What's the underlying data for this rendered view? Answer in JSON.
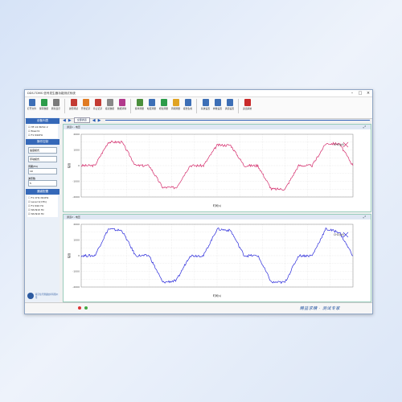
{
  "window": {
    "title": "DDS-TDMS 信号发生器功能测试系统"
  },
  "toolbar": [
    {
      "label": "打开文件",
      "color": "#3d6fb6"
    },
    {
      "label": "保存数据",
      "color": "#2c9c4a"
    },
    {
      "label": "刷新显示",
      "color": "#7a7a7a"
    },
    {
      "label": "波形测试",
      "color": "#c33b34"
    },
    {
      "label": "开始记录",
      "color": "#e07b22"
    },
    {
      "label": "停止记录",
      "color": "#c33b34"
    },
    {
      "label": "报表数据",
      "color": "#888888"
    },
    {
      "label": "数据清除",
      "color": "#b23a8c"
    },
    {
      "label": "频率测量",
      "color": "#4a8f3c"
    },
    {
      "label": "幅度测量",
      "color": "#3d6fb6"
    },
    {
      "label": "相位测量",
      "color": "#2c9c4a"
    },
    {
      "label": "周期测量",
      "color": "#e0a322"
    },
    {
      "label": "报告生成",
      "color": "#3d6fb6"
    },
    {
      "label": "系统设置",
      "color": "#3d6fb6"
    },
    {
      "label": "参数设置",
      "color": "#3d6fb6"
    },
    {
      "label": "通道设置",
      "color": "#3d6fb6"
    },
    {
      "label": "退出系统",
      "color": "#c92a2a"
    }
  ],
  "sidebar": {
    "device_header": "设备列表",
    "device_items": [
      "☑ HF-CX BVSC 2",
      "  ☑ Board1",
      "  ☑ F1 N10Hz"
    ],
    "ops_header": "操作控制",
    "controls": [
      {
        "label": "",
        "value": "速度模式"
      },
      {
        "label": "",
        "value": "手动模式"
      },
      {
        "label": "周期(Hz)",
        "value": "10"
      },
      {
        "label": "波形数",
        "value": "5"
      }
    ],
    "channel_header": "通道配置",
    "channel_items": [
      "☐ F1 CH1 N10Hz",
      "☑ Level 1(CH1)",
      "☑ F1 N10 Hz",
      "☑ SN-N10 Hz",
      "☑ SN-N10 Hz"
    ],
    "company": "南京信号测试技术有限公司"
  },
  "nav": {
    "select": "全部通道"
  },
  "panels": [
    {
      "title": "通道1 - 电压",
      "legend": "CH1(μV)",
      "xlabel": "时间(s)",
      "ylabel": "幅值",
      "color": "#d42a6a",
      "ylim": [
        -2000,
        2000
      ]
    },
    {
      "title": "通道2 - 电压",
      "legend": "CH2(μV)",
      "xlabel": "时间(s)",
      "ylabel": "幅值",
      "color": "#2a2adb",
      "ylim": [
        -2000,
        2000
      ]
    }
  ],
  "chart_data": [
    {
      "type": "line",
      "series": [
        {
          "name": "CH1(μV)",
          "x": [
            0,
            1,
            2,
            3,
            4,
            5,
            6,
            7,
            8,
            9,
            10,
            11,
            12,
            13,
            14,
            15,
            16,
            17,
            18,
            19,
            20
          ],
          "y": [
            0,
            0,
            1500,
            1500,
            0,
            0,
            -1400,
            -1400,
            0,
            0,
            1300,
            1300,
            0,
            0,
            -1500,
            -1500,
            0,
            0,
            1400,
            1400,
            0
          ]
        }
      ],
      "ylim": [
        -2000,
        2000
      ]
    },
    {
      "type": "line",
      "series": [
        {
          "name": "CH2(μV)",
          "x": [
            0,
            1,
            2,
            3,
            4,
            5,
            6,
            7,
            8,
            9,
            10,
            11,
            12,
            13,
            14,
            15,
            16,
            17,
            18,
            19,
            20
          ],
          "y": [
            0,
            0,
            1700,
            1600,
            0,
            0,
            -1700,
            -1600,
            0,
            0,
            1700,
            1600,
            0,
            0,
            -1700,
            -1700,
            0,
            0,
            1700,
            1500,
            0
          ]
        }
      ],
      "ylim": [
        -2000,
        2000
      ]
    }
  ],
  "status": {
    "brand": "精益求精 · 测试专家"
  }
}
